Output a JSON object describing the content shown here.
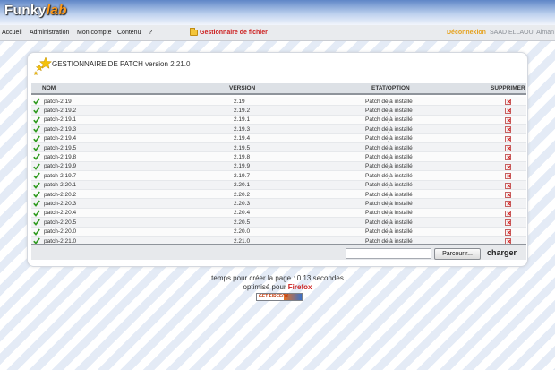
{
  "header": {
    "logo_main": "Funky",
    "logo_accent": "lab"
  },
  "nav": {
    "items": [
      {
        "label": "Accueil"
      },
      {
        "label": "Administration"
      },
      {
        "label": "Mon compte"
      },
      {
        "label": "Contenu"
      },
      {
        "label": "?"
      }
    ],
    "file_manager": "Gestionnaire de fichier",
    "logout": "Déconnexion",
    "user": "SAAD ELLAOUI Aiman"
  },
  "panel": {
    "title": "GESTIONNAIRE DE PATCH version",
    "version": "2.21.0",
    "columns": {
      "name": "NOM",
      "version": "VERSION",
      "state": "ETAT/OPTION",
      "delete": "SUPPRIMER"
    },
    "rows": [
      {
        "name": "patch-2.19",
        "version": "2.19",
        "state": "Patch déjà installé"
      },
      {
        "name": "patch-2.19.2",
        "version": "2.19.2",
        "state": "Patch déjà installé"
      },
      {
        "name": "patch-2.19.1",
        "version": "2.19.1",
        "state": "Patch déjà installé"
      },
      {
        "name": "patch-2.19.3",
        "version": "2.19.3",
        "state": "Patch déjà installé"
      },
      {
        "name": "patch-2.19.4",
        "version": "2.19.4",
        "state": "Patch déjà installé"
      },
      {
        "name": "patch-2.19.5",
        "version": "2.19.5",
        "state": "Patch déjà installé"
      },
      {
        "name": "patch-2.19.8",
        "version": "2.19.8",
        "state": "Patch déjà installé"
      },
      {
        "name": "patch-2.19.9",
        "version": "2.19.9",
        "state": "Patch déjà installé"
      },
      {
        "name": "patch-2.19.7",
        "version": "2.19.7",
        "state": "Patch déjà installé"
      },
      {
        "name": "patch-2.20.1",
        "version": "2.20.1",
        "state": "Patch déjà installé"
      },
      {
        "name": "patch-2.20.2",
        "version": "2.20.2",
        "state": "Patch déjà installé"
      },
      {
        "name": "patch-2.20.3",
        "version": "2.20.3",
        "state": "Patch déjà installé"
      },
      {
        "name": "patch-2.20.4",
        "version": "2.20.4",
        "state": "Patch déjà installé"
      },
      {
        "name": "patch-2.20.5",
        "version": "2.20.5",
        "state": "Patch déjà installé"
      },
      {
        "name": "patch-2.20.0",
        "version": "2.20.0",
        "state": "Patch déjà installé"
      },
      {
        "name": "patch-2.21.0",
        "version": "2.21.0",
        "state": "Patch déjà installé"
      }
    ],
    "browse_label": "Parcourir...",
    "upload_label": "charger"
  },
  "footer": {
    "timing": "temps pour créer la page : 0.13 secondes",
    "optimized": "optimisé pour",
    "firefox": "Firefox",
    "badge": "GET FIREFOX"
  },
  "colors": {
    "accent_red": "#cc1f1f",
    "logout_orange": "#e6a21d",
    "check_green": "#2e9a1e"
  }
}
